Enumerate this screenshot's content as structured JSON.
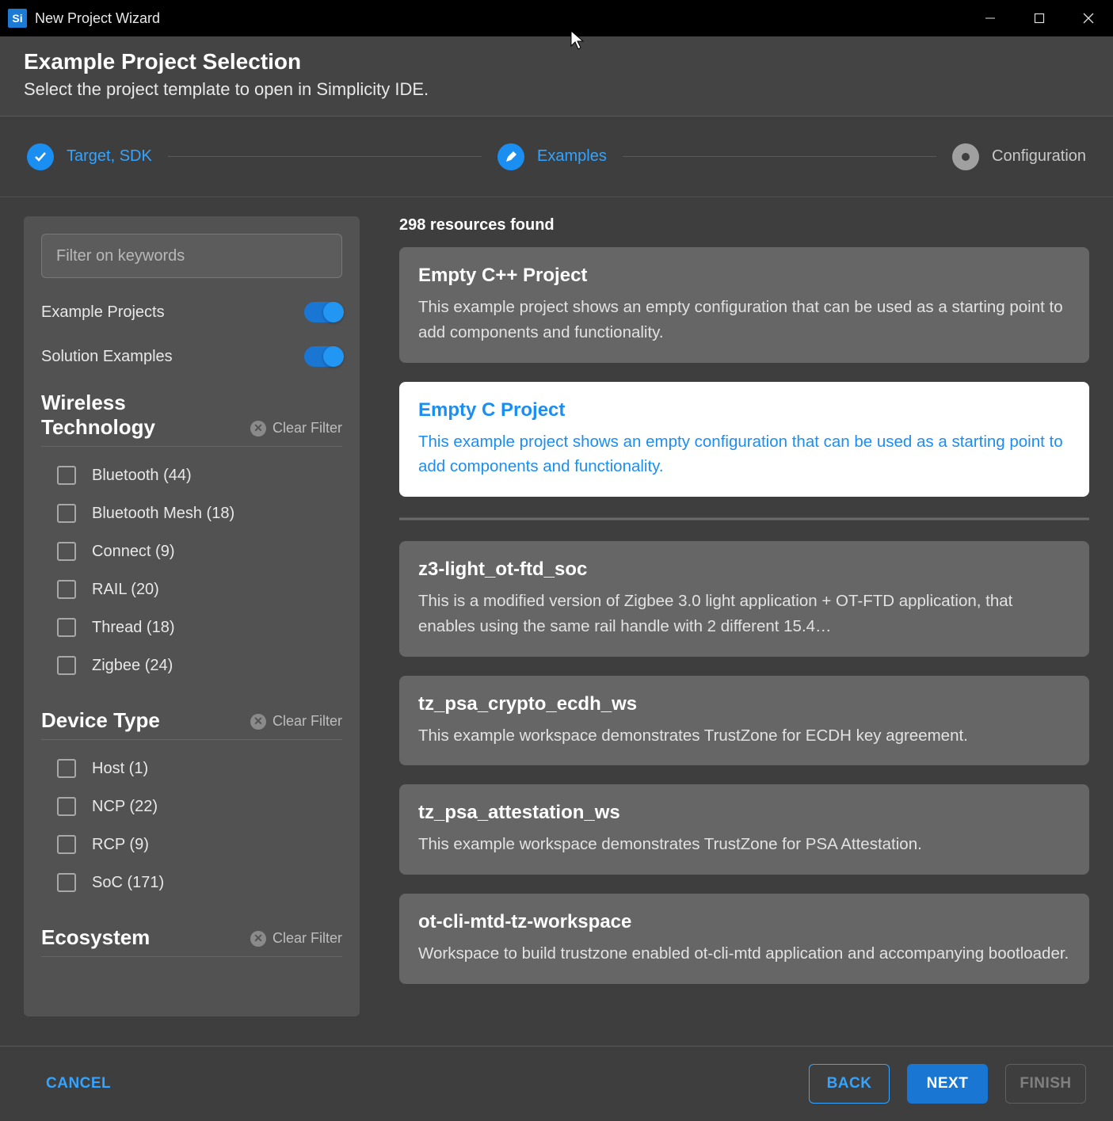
{
  "window": {
    "logo_text": "Si",
    "title": "New Project Wizard"
  },
  "header": {
    "title": "Example Project Selection",
    "subtitle": "Select the project template to open in Simplicity IDE."
  },
  "stepper": {
    "step1": "Target, SDK",
    "step2": "Examples",
    "step3": "Configuration"
  },
  "sidebar": {
    "filter_placeholder": "Filter on keywords",
    "toggle_examples_label": "Example Projects",
    "toggle_solutions_label": "Solution Examples",
    "groups": [
      {
        "title": "Wireless Technology",
        "clear_label": "Clear Filter",
        "items": [
          "Bluetooth (44)",
          "Bluetooth Mesh (18)",
          "Connect (9)",
          "RAIL (20)",
          "Thread (18)",
          "Zigbee (24)"
        ]
      },
      {
        "title": "Device Type",
        "clear_label": "Clear Filter",
        "items": [
          "Host (1)",
          "NCP (22)",
          "RCP (9)",
          "SoC (171)"
        ]
      },
      {
        "title": "Ecosystem",
        "clear_label": "Clear Filter",
        "items": []
      }
    ]
  },
  "results": {
    "count_text": "298 resources found",
    "cards": [
      {
        "title": "Empty C++ Project",
        "desc": "This example project shows an empty configuration that can be used as a starting point to add components and functionality.",
        "selected": false
      },
      {
        "title": "Empty C Project",
        "desc": "This example project shows an empty configuration that can be used as a starting point to add components and functionality.",
        "selected": true
      },
      {
        "title": "z3-light_ot-ftd_soc",
        "desc": "This is a modified version of Zigbee 3.0 light application + OT-FTD application, that enables using the same rail handle with 2 different 15.4…",
        "selected": false
      },
      {
        "title": "tz_psa_crypto_ecdh_ws",
        "desc": "This example workspace demonstrates TrustZone for ECDH key agreement.",
        "selected": false
      },
      {
        "title": "tz_psa_attestation_ws",
        "desc": "This example workspace demonstrates TrustZone for PSA Attestation.",
        "selected": false
      },
      {
        "title": "ot-cli-mtd-tz-workspace",
        "desc": "Workspace to build trustzone enabled ot-cli-mtd application and accompanying bootloader.",
        "selected": false
      }
    ]
  },
  "footer": {
    "cancel": "CANCEL",
    "back": "BACK",
    "next": "NEXT",
    "finish": "FINISH"
  }
}
